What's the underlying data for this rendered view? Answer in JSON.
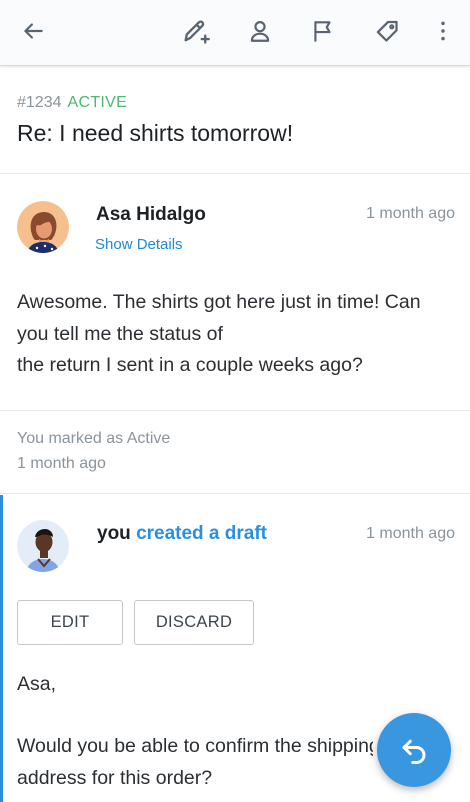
{
  "toolbar": {
    "icons": [
      "back-arrow-icon",
      "edit-note-icon",
      "assign-user-icon",
      "flag-icon",
      "tag-icon",
      "more-vertical-icon"
    ],
    "icon_color": "#5a6470"
  },
  "conversation": {
    "number": "#1234",
    "status": "ACTIVE",
    "status_color": "#4cba6a",
    "title": "Re: I need shirts tomorrow!"
  },
  "message": {
    "author": "Asa Hidalgo",
    "show_details_label": "Show Details",
    "time": "1 month ago",
    "body_line1": "Awesome. The shirts got here just in time! Can",
    "body_line2": "you tell me the status of",
    "body_line3": "the return I sent in a couple weeks ago?"
  },
  "status_note": {
    "text": "You marked as Active",
    "time": "1 month ago"
  },
  "draft": {
    "author": "you",
    "action": "created a draft",
    "time": "1 month ago",
    "edit_label": "EDIT",
    "discard_label": "DISCARD",
    "greeting": "Asa,",
    "body_line1": "Would you be able to confirm the shipping",
    "body_line2": "address for this order?",
    "accent_color": "#2b8fe0"
  },
  "fab": {
    "icon": "reply-icon",
    "color": "#3897df"
  }
}
